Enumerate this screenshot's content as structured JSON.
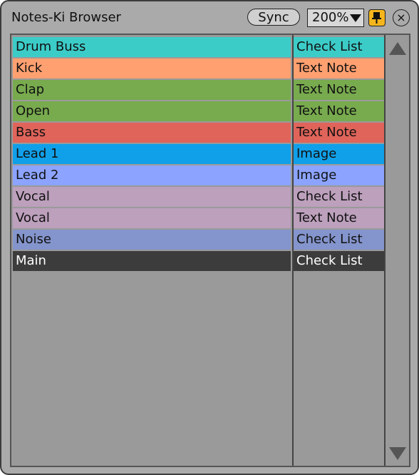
{
  "window": {
    "title": "Notes-Ki Browser"
  },
  "toolbar": {
    "sync_label": "Sync",
    "zoom_value": "200%",
    "pin_icon": "pin-icon",
    "close_icon": "close-icon",
    "close_glyph": "×"
  },
  "colors": {
    "window_bg": "#aaaaaa",
    "panel_bg": "#9a9a9a",
    "pin_bg": "#f5b51c"
  },
  "rows": [
    {
      "name": "Drum Buss",
      "type": "Check List",
      "color": "#3cccc8",
      "text_color": "#111111"
    },
    {
      "name": "Kick",
      "type": "Text Note",
      "color": "#ffa070",
      "text_color": "#111111"
    },
    {
      "name": "Clap",
      "type": "Text Note",
      "color": "#78aa4e",
      "text_color": "#111111"
    },
    {
      "name": "Open",
      "type": "Text Note",
      "color": "#78aa4e",
      "text_color": "#111111"
    },
    {
      "name": "Bass",
      "type": "Text Note",
      "color": "#e0645a",
      "text_color": "#111111"
    },
    {
      "name": "Lead 1",
      "type": "Image",
      "color": "#10a0ea",
      "text_color": "#111111"
    },
    {
      "name": "Lead 2",
      "type": "Image",
      "color": "#8ca4ff",
      "text_color": "#111111"
    },
    {
      "name": "Vocal",
      "type": "Check List",
      "color": "#bca0bc",
      "text_color": "#111111"
    },
    {
      "name": "Vocal",
      "type": "Text Note",
      "color": "#bca0bc",
      "text_color": "#111111"
    },
    {
      "name": "Noise",
      "type": "Check List",
      "color": "#8494cc",
      "text_color": "#111111"
    },
    {
      "name": "Main",
      "type": "Check List",
      "color": "#3c3c3c",
      "text_color": "#ffffff"
    }
  ]
}
